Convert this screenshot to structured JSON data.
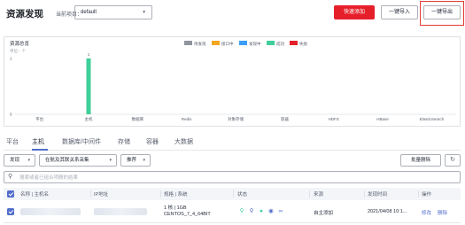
{
  "header": {
    "title": "资源发现",
    "project_label": "当前项目：",
    "project_value": "default",
    "quick_add": "快速添加",
    "import": "一键导入",
    "export": "一键导出"
  },
  "chart_data": {
    "type": "bar",
    "title": "资源总览",
    "subtitle": "单位：个",
    "categories": [
      "平台",
      "主机",
      "数据库",
      "Redis",
      "对象存储",
      "容器",
      "HDFS",
      "HBase",
      "ElasticSearch"
    ],
    "series": [
      {
        "name": "待发现",
        "color": "#8f959e",
        "values": [
          0,
          0,
          0,
          0,
          0,
          0,
          0,
          0,
          0
        ]
      },
      {
        "name": "接口中",
        "color": "#f6a623",
        "values": [
          0,
          0,
          0,
          0,
          0,
          0,
          0,
          0,
          0
        ]
      },
      {
        "name": "发现中",
        "color": "#3a9dfa",
        "values": [
          0,
          0,
          0,
          0,
          0,
          0,
          0,
          0,
          0
        ]
      },
      {
        "name": "成功",
        "color": "#3ecf9a",
        "values": [
          0,
          1,
          0,
          0,
          0,
          0,
          0,
          0,
          0
        ]
      },
      {
        "name": "失败",
        "color": "#e6202b",
        "values": [
          0,
          0,
          0,
          0,
          0,
          0,
          0,
          0,
          0
        ]
      }
    ],
    "data_labels": [
      "",
      "1",
      "",
      "",
      "",
      "",
      "",
      "",
      ""
    ],
    "yticks": [
      "0",
      "1"
    ],
    "ylim": [
      0,
      1
    ],
    "legend": "top-center",
    "grid": false
  },
  "tabs": [
    "平台",
    "主机",
    "数据库/中间件",
    "存储",
    "容器",
    "大数据"
  ],
  "active_tab": "主机",
  "filters": {
    "discover": "发现",
    "by_type": "在航及其联关系采集",
    "recommend": "推荐"
  },
  "toolbar": {
    "bulk_delete": "批量删除",
    "refresh_icon": "refresh-icon"
  },
  "search": {
    "placeholder": "搜索或者已组合项删的结果"
  },
  "table": {
    "columns": [
      "名称 | 主机名",
      "IP地址",
      "规格 | 系统",
      "状态",
      "来源",
      "发现时间",
      "操作"
    ],
    "rows": [
      {
        "spec_line1": "1 核 | 1GB",
        "spec_line2": "CENTOS_7_4_64BIT",
        "source": "自主添加",
        "time": "2021/04/08 10:1...",
        "actions": [
          "修改",
          "删除"
        ]
      }
    ]
  },
  "status_icon_colors": [
    "#3ecf9a",
    "#526ecc",
    "#3ecf9a",
    "#526ecc",
    "#526ecc"
  ]
}
